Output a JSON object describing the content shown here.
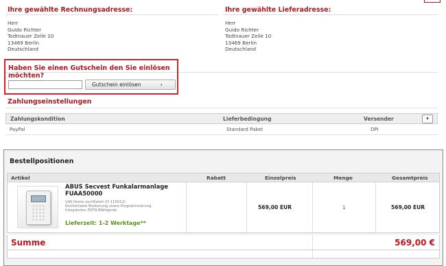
{
  "billing": {
    "title": "Ihre gewählte Rechnungsadresse:",
    "lines": [
      "Herr",
      "Guido Richter",
      "Todtnauer Zeile 10",
      "13469 Berlin",
      "Deutschland"
    ]
  },
  "shipping": {
    "title": "Ihre gewählte Lieferadresse:",
    "lines": [
      "Herr",
      "Guido Richter",
      "Todtnauer Zeile 10",
      "13469 Berlin",
      "Deutschland"
    ]
  },
  "voucher": {
    "title": "Haben Sie einen Gutschein den Sie einlösen möchten?",
    "input_value": "",
    "button_label": "Gutschein einlösen",
    "button_icon": "chevron-right-icon"
  },
  "payment": {
    "title": "Zahlungseinstellungen",
    "headers": [
      "Zahlungskondition",
      "Lieferbedingung",
      "Versender"
    ],
    "row": [
      "PayPal",
      "Standard Paket",
      "DPI"
    ],
    "dropdown_icon": "chevron-down-icon"
  },
  "order": {
    "title": "Bestellpositionen",
    "headers": [
      "Artikel",
      "Rabatt",
      "Einzelpreis",
      "Menge",
      "Gesamtpreis"
    ],
    "item": {
      "name": "ABUS Secvest Funkalarmanlage FUAA50000",
      "desc": [
        "VdS Home zertifiziert (H 115012)",
        "Komfortable Bedienung sowie Programmierung",
        "Integriertes PSTN-Wählgerät"
      ],
      "delivery": "Lieferzeit: 1-2 Werktage**",
      "discount": "",
      "unit_price": "569,00 EUR",
      "quantity": "1",
      "total": "569,00 EUR"
    },
    "sum_label": "Summe",
    "sum_value": "569,00 €"
  },
  "colors": {
    "accent": "#b0161e",
    "delivery": "#5a8f20",
    "highlight_border": "#d31f26"
  }
}
